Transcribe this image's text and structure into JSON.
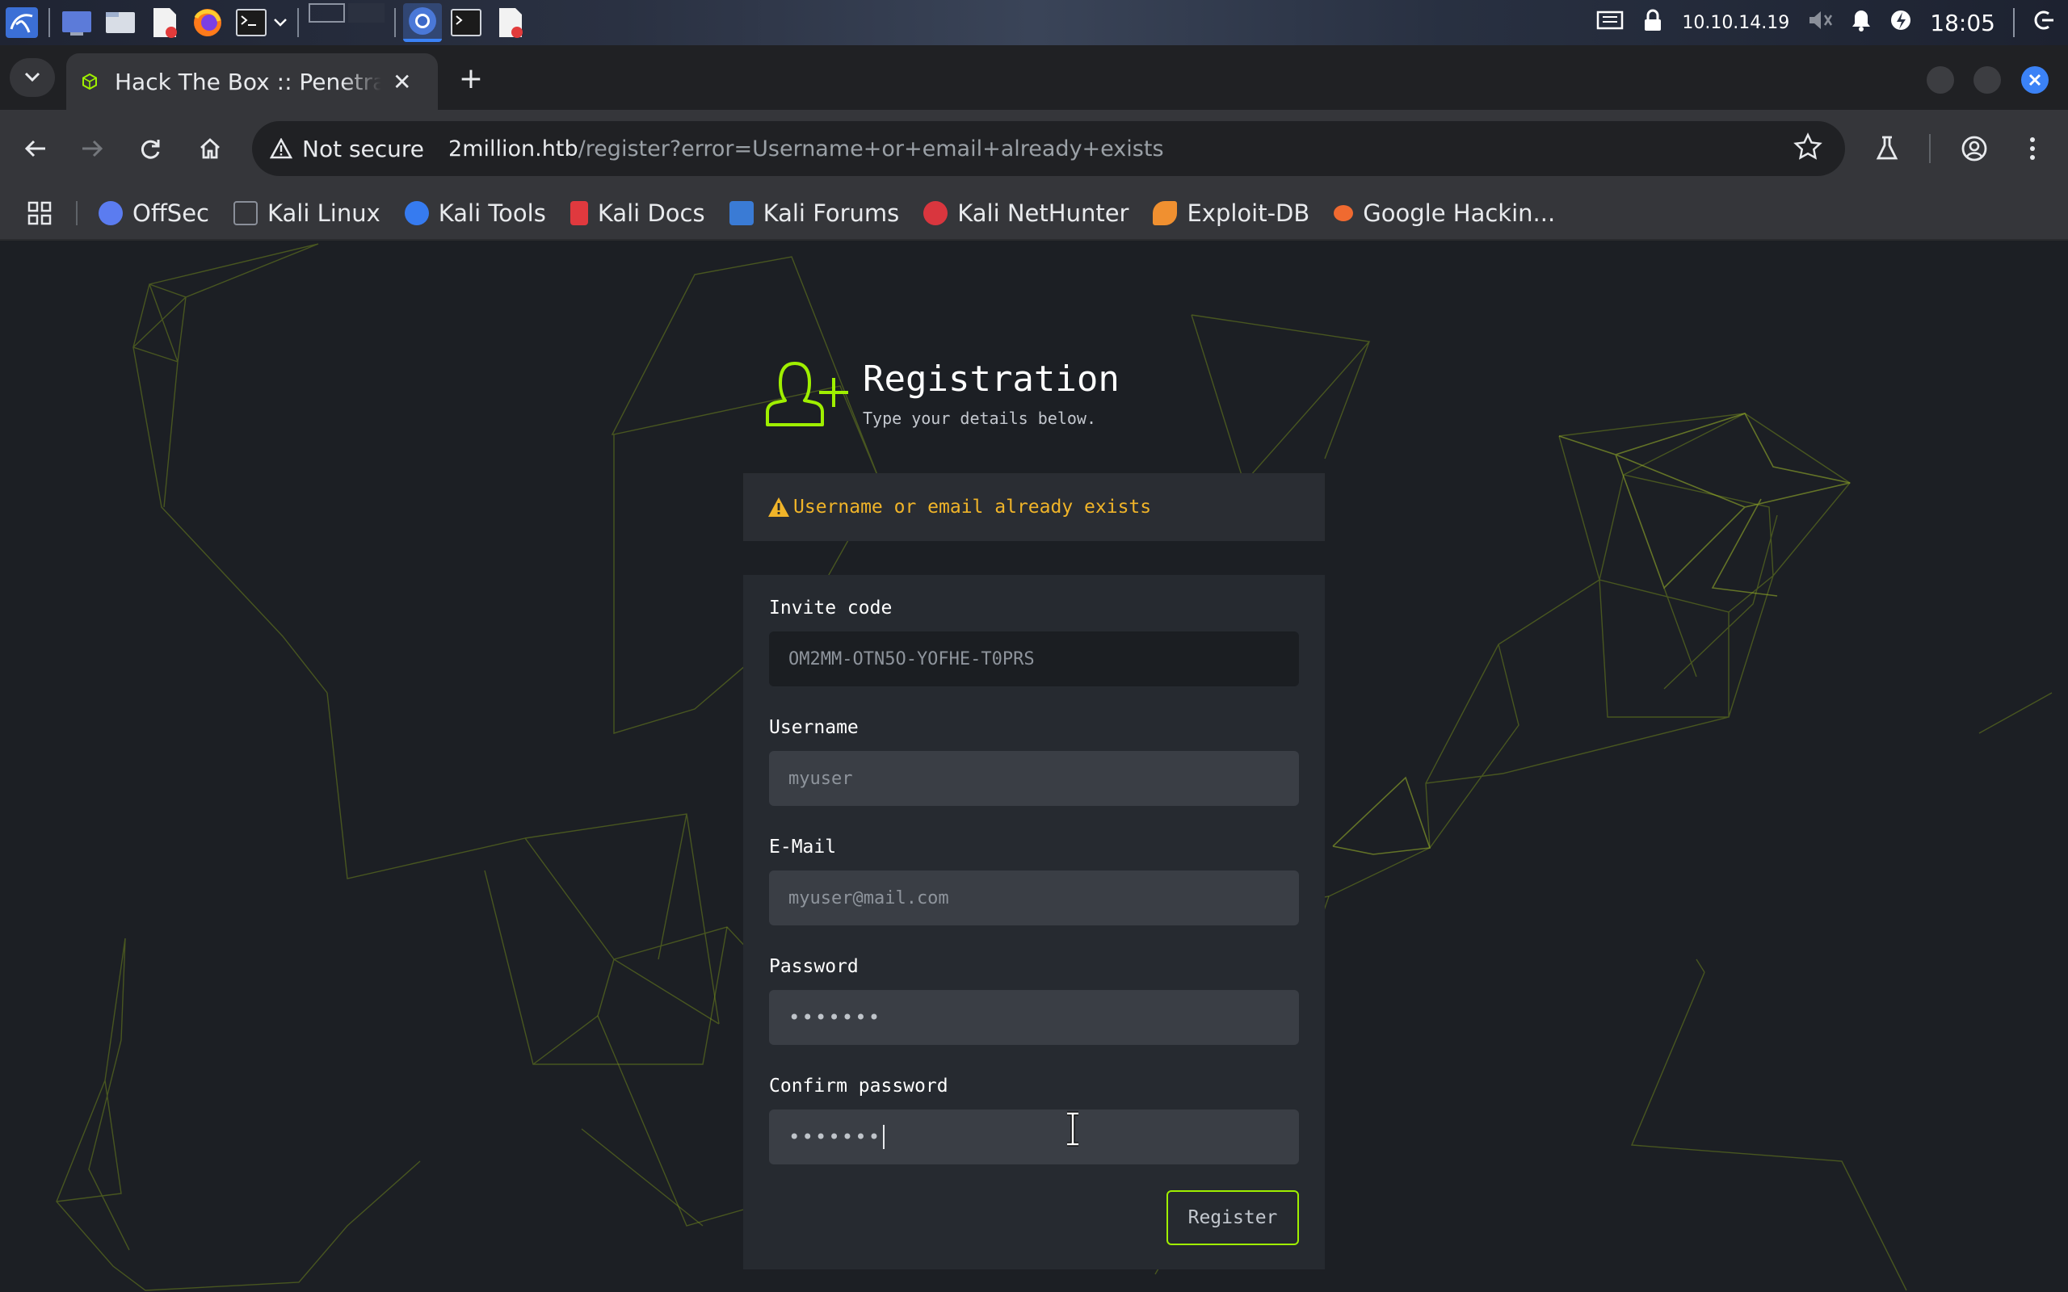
{
  "system_panel": {
    "ip": "10.10.14.19",
    "clock": "18:05"
  },
  "browser": {
    "tab_title": "Hack The Box :: Penetration Testing Labs",
    "new_tab": "+",
    "tab_close": "✕",
    "security_label": "Not secure",
    "url_host": "2million.htb",
    "url_path": "/register?error=Username+or+email+already+exists"
  },
  "bookmarks": [
    {
      "label": "OffSec",
      "color": "#5b7cf0"
    },
    {
      "label": "Kali Linux",
      "color": "#8a8f99"
    },
    {
      "label": "Kali Tools",
      "color": "#367bf0"
    },
    {
      "label": "Kali Docs",
      "color": "#e0393e"
    },
    {
      "label": "Kali Forums",
      "color": "#3a7bd5"
    },
    {
      "label": "Kali NetHunter",
      "color": "#d9363e"
    },
    {
      "label": "Exploit-DB",
      "color": "#f09030"
    },
    {
      "label": "Google Hackin...",
      "color": "#f06a30"
    }
  ],
  "registration": {
    "title": "Registration",
    "subtitle": "Type your details below.",
    "error": "Username or email already exists",
    "fields": {
      "invite_label": "Invite code",
      "invite_value": "OM2MM-OTN5O-YOFHE-T0PRS",
      "username_label": "Username",
      "username_placeholder": "myuser",
      "email_label": "E-Mail",
      "email_placeholder": "myuser@mail.com",
      "password_label": "Password",
      "password_value": "•••••••",
      "confirm_label": "Confirm password",
      "confirm_value": "•••••••"
    },
    "submit_label": "Register",
    "accent": "#9fef00",
    "warning_color": "#f0b429"
  }
}
